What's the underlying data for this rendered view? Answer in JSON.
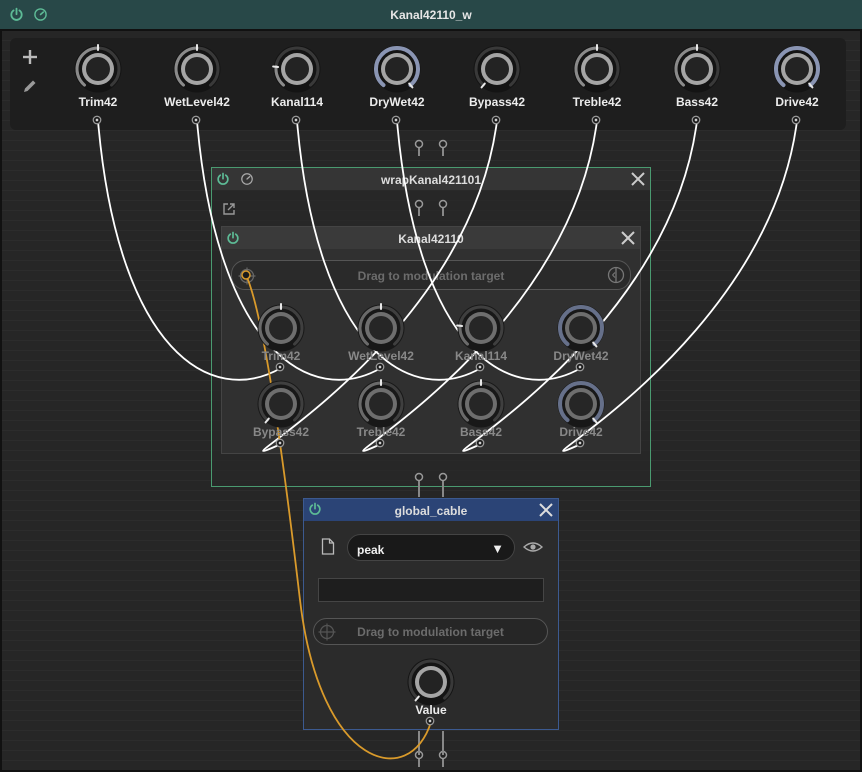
{
  "window": {
    "title": "Kanal42110_w"
  },
  "toolbar": {
    "add_icon": "plus-icon",
    "edit_icon": "pencil-icon"
  },
  "top_params": [
    {
      "label": "Trim42",
      "value": 0.5,
      "style": "plain"
    },
    {
      "label": "WetLevel42",
      "value": 0.5,
      "style": "plain"
    },
    {
      "label": "Kanal114",
      "value": 0.2,
      "style": "plain"
    },
    {
      "label": "DryWet42",
      "value": 1.0,
      "style": "ring"
    },
    {
      "label": "Bypass42",
      "value": 0.0,
      "style": "plain"
    },
    {
      "label": "Treble42",
      "value": 0.5,
      "style": "plain"
    },
    {
      "label": "Bass42",
      "value": 0.5,
      "style": "plain"
    },
    {
      "label": "Drive42",
      "value": 1.0,
      "style": "ring"
    }
  ],
  "wrap_node": {
    "title": "wrapKanal421101",
    "popout_icon": "popout-icon"
  },
  "inner_node": {
    "title": "Kanal42110",
    "drag_text": "Drag to modulation target",
    "params": [
      {
        "label": "Trim42",
        "value": 0.5,
        "style": "plain"
      },
      {
        "label": "WetLevel42",
        "value": 0.5,
        "style": "plain"
      },
      {
        "label": "Kanal114",
        "value": 0.2,
        "style": "plain"
      },
      {
        "label": "DryWet42",
        "value": 1.0,
        "style": "ring"
      },
      {
        "label": "Bypass42",
        "value": 0.0,
        "style": "plain"
      },
      {
        "label": "Treble42",
        "value": 0.5,
        "style": "plain"
      },
      {
        "label": "Bass42",
        "value": 0.5,
        "style": "plain"
      },
      {
        "label": "Drive42",
        "value": 1.0,
        "style": "ring"
      }
    ]
  },
  "global_cable": {
    "title": "global_cable",
    "selected": "peak",
    "drag_text": "Drag to modulation target",
    "value_label": "Value",
    "value": 0.0
  },
  "colors": {
    "title_bar": "#284848",
    "power_green": "#5dbb96",
    "wrap_border": "#4a9a70",
    "global_header": "#2b4476",
    "global_border": "#3c5a90",
    "modulation_cable": "#d99a2b",
    "cable": "#ffffff"
  }
}
